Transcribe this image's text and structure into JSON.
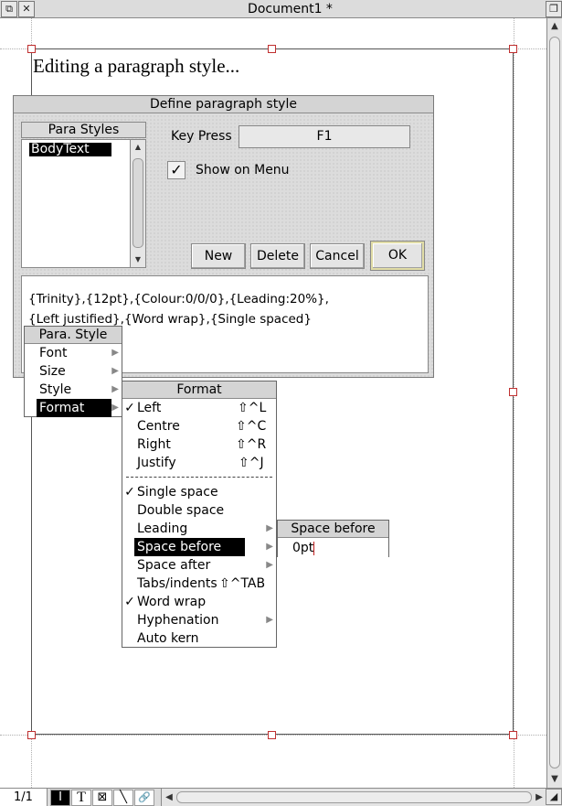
{
  "window": {
    "title": "Document1 *",
    "back_icon": "window-back-icon",
    "close_icon": "close-icon",
    "toggle_icon": "toggle-size-icon"
  },
  "document": {
    "heading": "Editing a paragraph style..."
  },
  "dialog": {
    "title": "Define paragraph style",
    "list_heading": "Para Styles",
    "list_items": [
      "BodyText"
    ],
    "key_press_label": "Key Press",
    "key_press_value": "F1",
    "show_on_menu_label": "Show on Menu",
    "show_on_menu_checked": "✓",
    "buttons": {
      "new": "New",
      "delete": "Delete",
      "cancel": "Cancel",
      "ok": "OK"
    },
    "description_line1": "{Trinity},{12pt},{Colour:0/0/0},{Leading:20%},",
    "description_line2": "{Left justified},{Word wrap},{Single spaced}"
  },
  "para_style_menu": {
    "title": "Para. Style",
    "items": [
      "Font",
      "Size",
      "Style",
      "Format"
    ]
  },
  "format_menu": {
    "title": "Format",
    "align": [
      {
        "tick": "✓",
        "label": "Left",
        "shortcut": "⇧^L"
      },
      {
        "tick": "",
        "label": "Centre",
        "shortcut": "⇧^C"
      },
      {
        "tick": "",
        "label": "Right",
        "shortcut": "⇧^R"
      },
      {
        "tick": "",
        "label": "Justify",
        "shortcut": "⇧^J"
      }
    ],
    "options": [
      {
        "tick": "✓",
        "label": "Single space",
        "shortcut": ""
      },
      {
        "tick": "",
        "label": "Double space",
        "shortcut": ""
      },
      {
        "tick": "",
        "label": "Leading",
        "shortcut": ""
      },
      {
        "tick": "",
        "label": "Space before",
        "shortcut": ""
      },
      {
        "tick": "",
        "label": "Space after",
        "shortcut": ""
      },
      {
        "tick": "",
        "label": "Tabs/indents",
        "shortcut": "⇧^TAB"
      },
      {
        "tick": "✓",
        "label": "Word wrap",
        "shortcut": ""
      },
      {
        "tick": "",
        "label": "Hyphenation",
        "shortcut": ""
      },
      {
        "tick": "",
        "label": "Auto kern",
        "shortcut": ""
      }
    ]
  },
  "space_before_menu": {
    "title": "Space before",
    "value": "0pt"
  },
  "statusbar": {
    "page": "1/1",
    "tools": [
      "I",
      "T",
      "⊠",
      "╲",
      "🔗"
    ]
  }
}
